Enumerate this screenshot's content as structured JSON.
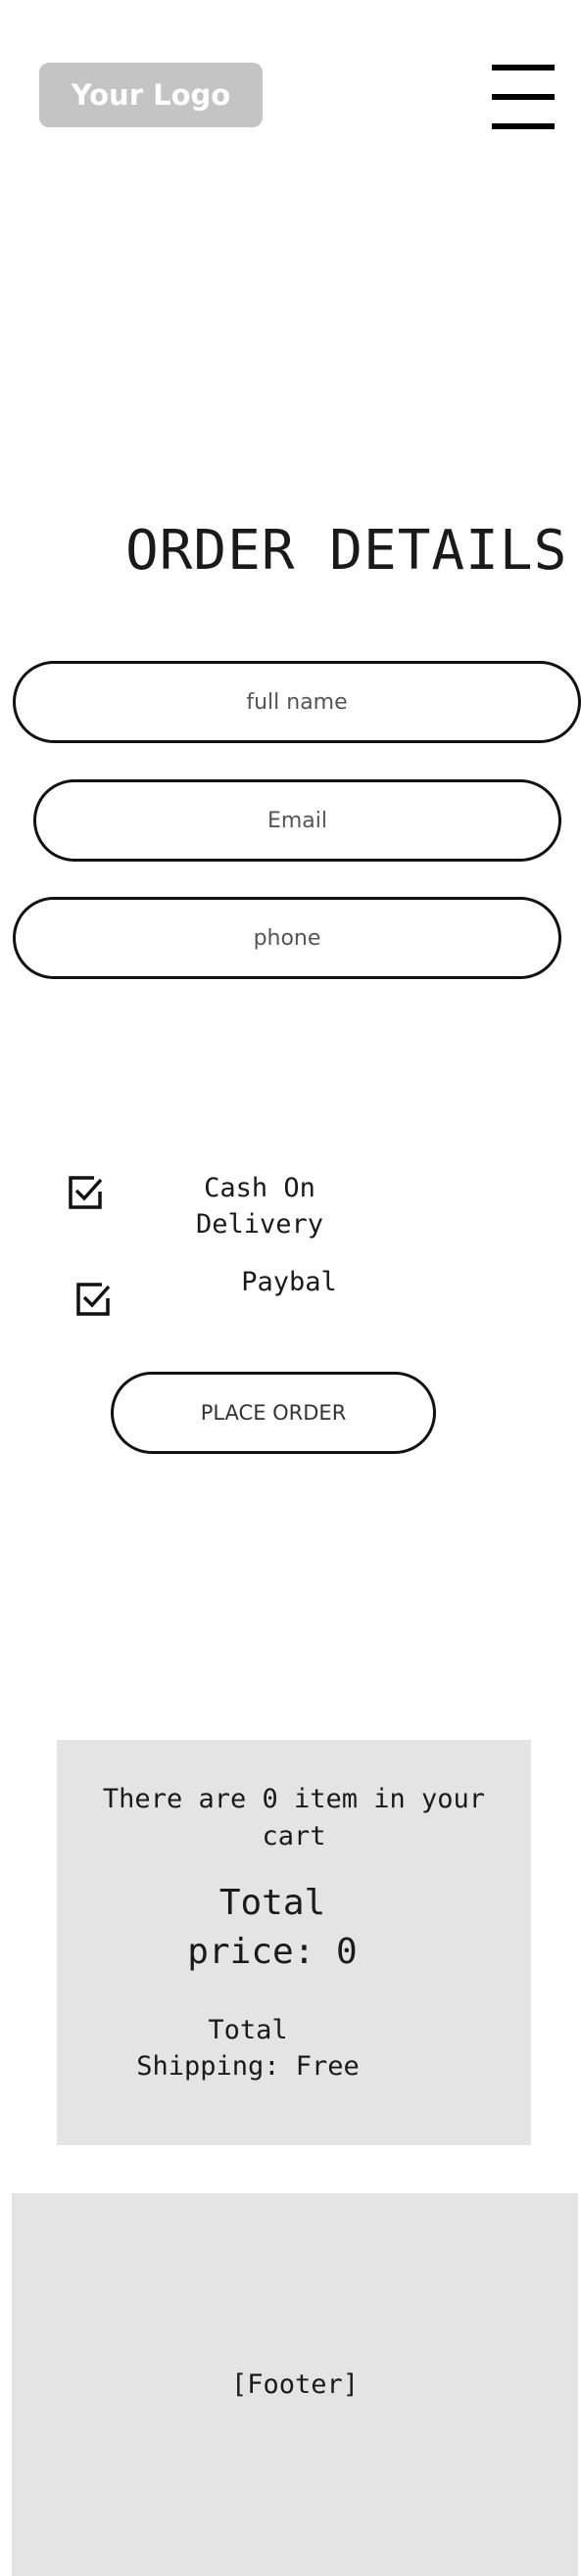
{
  "header": {
    "logo_text": "Your Logo",
    "menu_icon": "hamburger-menu-icon"
  },
  "main": {
    "title": "ORDER DETAILS",
    "fields": {
      "full_name_placeholder": "full name",
      "email_placeholder": "Email",
      "phone_placeholder": "phone"
    },
    "payment": {
      "cash_line1": "Cash On",
      "cash_line2": "Delivery",
      "paybal": "Paybal",
      "checkbox_icon": "checked-checkbox-icon"
    },
    "place_order_label": "PLACE ORDER"
  },
  "summary": {
    "count_line1": "There are 0 item in your",
    "count_line2": "cart",
    "price_line1": "Total",
    "price_line2": "price: 0",
    "shipping_line1": "Total",
    "shipping_line2": "Shipping: Free"
  },
  "footer": {
    "text": "[Footer]"
  },
  "colors": {
    "logo_bg": "#c4c4c4",
    "panel_bg": "#e4e4e4",
    "border": "#111111"
  }
}
